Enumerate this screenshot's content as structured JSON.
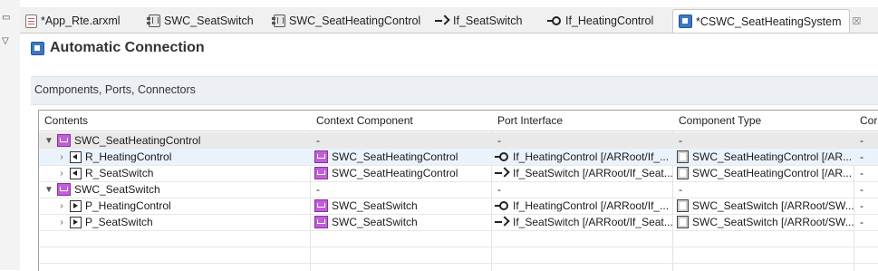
{
  "tabs": [
    {
      "label": "*App_Rte.arxml",
      "icon": "file-icon",
      "active": false
    },
    {
      "label": "SWC_SeatSwitch",
      "icon": "component-icon",
      "active": false
    },
    {
      "label": "SWC_SeatHeatingControl",
      "icon": "component-icon",
      "active": false
    },
    {
      "label": "If_SeatSwitch",
      "icon": "sender-receiver-interface-icon",
      "active": false
    },
    {
      "label": "If_HeatingControl",
      "icon": "client-server-interface-icon",
      "active": false
    },
    {
      "label": "*CSWC_SeatHeatingSystem",
      "icon": "composition-icon",
      "active": true
    }
  ],
  "tab_close_glyph": "☒",
  "page_title": "Automatic Connection",
  "section_label": "Components, Ports, Connectors",
  "table": {
    "columns": [
      "Contents",
      "Context Component",
      "Port Interface",
      "Component Type",
      "Cor"
    ],
    "rows": [
      {
        "level": 0,
        "kind": "component",
        "contents": "SWC_SeatHeatingControl",
        "context": "-",
        "iface": "-",
        "ctype": "-",
        "extra": "-"
      },
      {
        "level": 1,
        "kind": "r-port",
        "contents": "R_HeatingControl",
        "context": "SWC_SeatHeatingControl",
        "iface": "If_HeatingControl [/ARRoot/If_...",
        "ctype": "SWC_SeatHeatingControl [/AR...",
        "extra": "-"
      },
      {
        "level": 1,
        "kind": "r-port",
        "contents": "R_SeatSwitch",
        "context": "SWC_SeatHeatingControl",
        "iface": "If_SeatSwitch [/ARRoot/If_Seat...",
        "ctype": "SWC_SeatHeatingControl [/AR...",
        "extra": "-"
      },
      {
        "level": 0,
        "kind": "component",
        "contents": "SWC_SeatSwitch",
        "context": "-",
        "iface": "-",
        "ctype": "-",
        "extra": "-"
      },
      {
        "level": 1,
        "kind": "p-port",
        "contents": "P_HeatingControl",
        "context": "SWC_SeatSwitch",
        "iface": "If_HeatingControl [/ARRoot/If_...",
        "ctype": "SWC_SeatSwitch [/ARRoot/SW...",
        "extra": "-"
      },
      {
        "level": 1,
        "kind": "p-port",
        "contents": "P_SeatSwitch",
        "context": "SWC_SeatSwitch",
        "iface": "If_SeatSwitch [/ARRoot/If_Seat...",
        "ctype": "SWC_SeatSwitch [/ARRoot/SW...",
        "extra": "-"
      }
    ]
  },
  "colors": {
    "accent": "#3b78c4",
    "swc": "#c05fd6",
    "selected_row": "#eaf3fc"
  }
}
